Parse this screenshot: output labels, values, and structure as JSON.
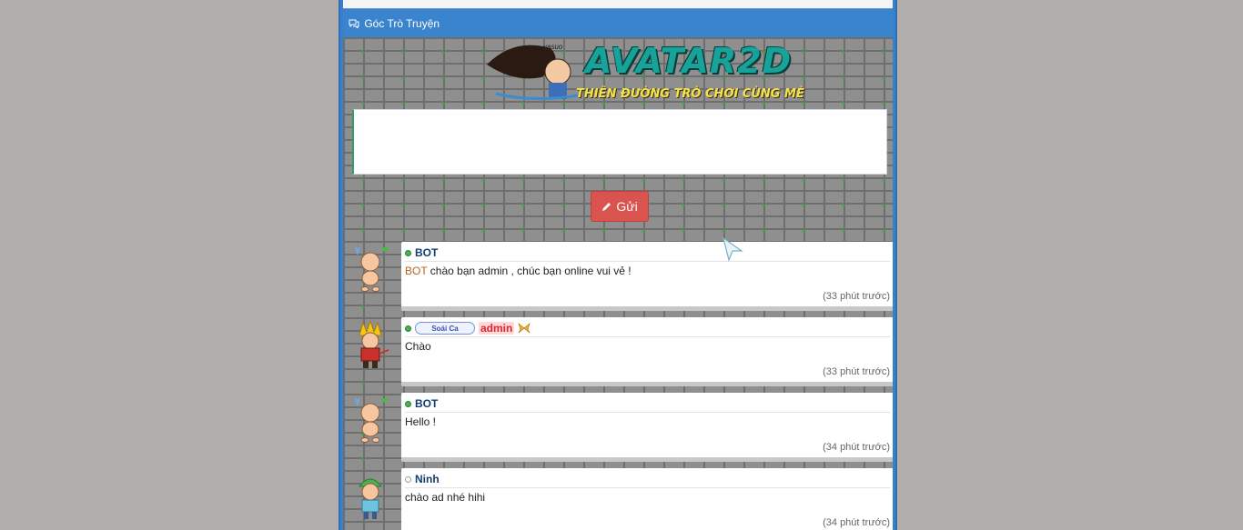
{
  "header": {
    "title": "Góc Trò Truyện",
    "icon": "comments-icon"
  },
  "logo": {
    "title": "AVATAR2D",
    "subtitle": "THIÊN ĐƯỜNG TRÒ CHƠI CÙNG MÈ",
    "signature": "yasuo"
  },
  "compose": {
    "message_value": "",
    "send_label": "Gửi",
    "send_icon": "pencil-icon"
  },
  "messages": [
    {
      "user": "BOT",
      "status": "online",
      "prefix": "BOT",
      "text": " chào bạn admin , chúc bạn online vui vẻ !",
      "time": "(33 phút trước)"
    },
    {
      "user": "admin",
      "badge": "Soái Ca",
      "status": "online",
      "text": "Chào",
      "time": "(33 phút trước)"
    },
    {
      "user": "BOT",
      "status": "online",
      "text": "Hello !",
      "time": "(34 phút trước)"
    },
    {
      "user": "Ninh",
      "status": "offline",
      "text": "chào ad nhé hihi",
      "time": "(34 phút trước)"
    }
  ],
  "colors": {
    "page_bg": "#b1aeac",
    "header_bg": "#3a84ce",
    "send_button": "#d9534f",
    "username": "#143d70",
    "admin_name": "#e0242a",
    "bot_prefix": "#b5651d"
  }
}
